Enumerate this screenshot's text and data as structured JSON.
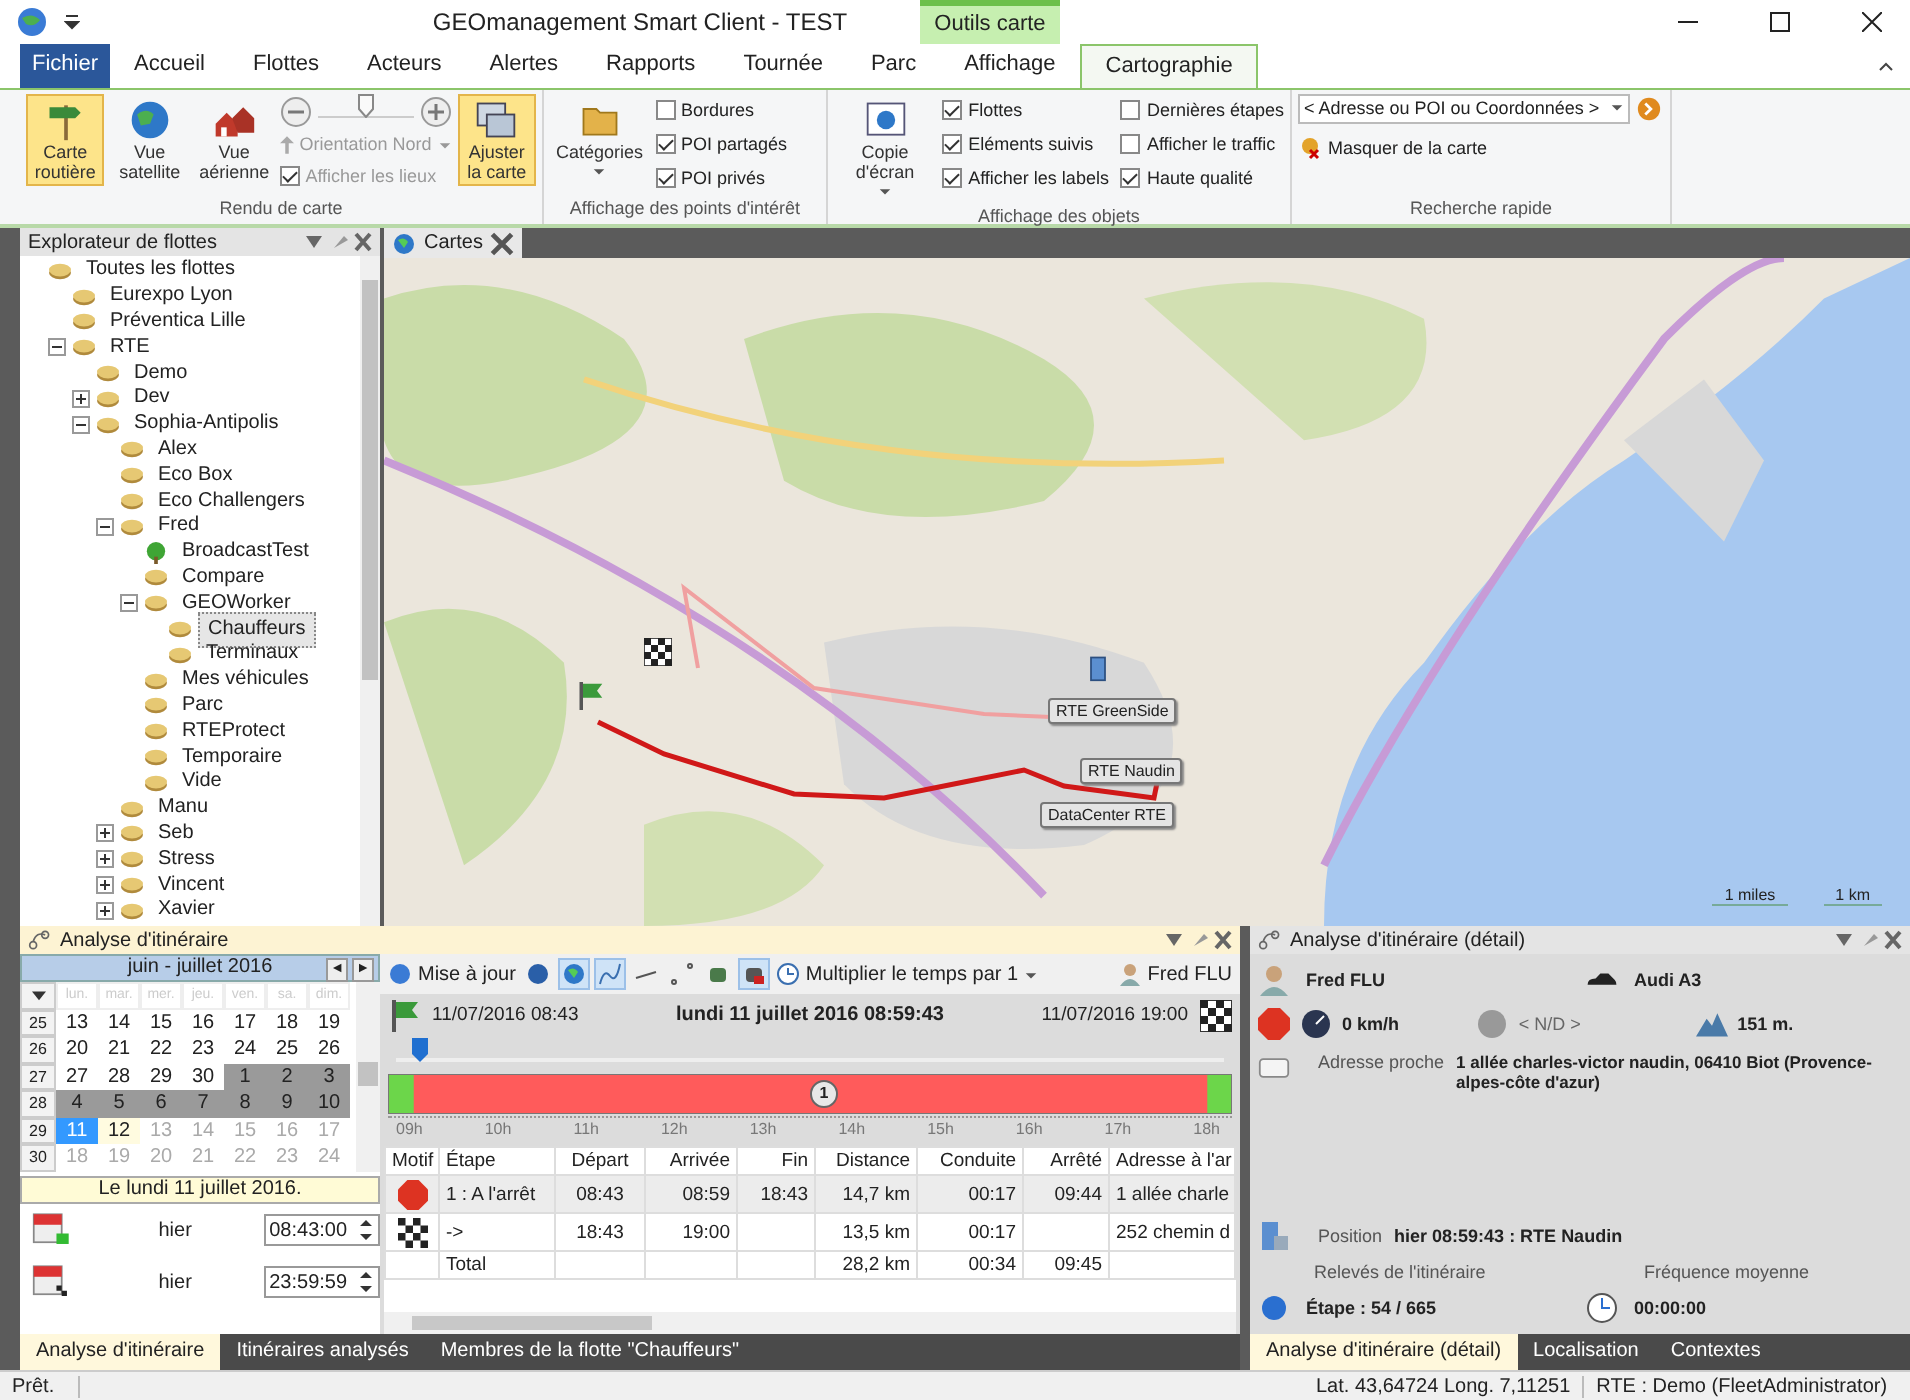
{
  "window": {
    "title": "GEOmanagement Smart Client - TEST",
    "context_tab": "Outils carte"
  },
  "ribbon_tabs": [
    {
      "label": "Fichier",
      "kind": "file",
      "selected": false
    },
    {
      "label": "Accueil",
      "kind": "tab",
      "selected": false
    },
    {
      "label": "Flottes",
      "kind": "tab",
      "selected": false
    },
    {
      "label": "Acteurs",
      "kind": "tab",
      "selected": false
    },
    {
      "label": "Alertes",
      "kind": "tab",
      "selected": false
    },
    {
      "label": "Rapports",
      "kind": "tab",
      "selected": false
    },
    {
      "label": "Tournée",
      "kind": "tab",
      "selected": false
    },
    {
      "label": "Parc",
      "kind": "tab",
      "selected": false
    },
    {
      "label": "Affichage",
      "kind": "tab",
      "selected": false
    },
    {
      "label": "Cartographie",
      "kind": "context",
      "selected": true
    }
  ],
  "ribbon": {
    "rendu": {
      "label": "Rendu de carte",
      "views": [
        {
          "label": "Carte routière",
          "kind": "road",
          "selected": true
        },
        {
          "label": "Vue satellite",
          "kind": "globe",
          "selected": false
        },
        {
          "label": "Vue aérienne",
          "kind": "houses",
          "selected": false
        }
      ],
      "orientation": {
        "label": "Orientation Nord",
        "disabled": true
      },
      "zoom": {
        "level": 0.5
      },
      "show_places": {
        "label": "Afficher les lieux",
        "checked": true,
        "disabled": true
      },
      "fit": {
        "label": "Ajuster la carte",
        "selected": true
      }
    },
    "poi": {
      "label": "Affichage des points d'intérêt",
      "categories": "Catégories",
      "checks": [
        {
          "label": "Bordures",
          "checked": false
        },
        {
          "label": "POI partagés",
          "checked": true
        },
        {
          "label": "POI privés",
          "checked": true
        }
      ]
    },
    "objects": {
      "label": "Affichage des objets",
      "screenshot": "Copie d'écran",
      "checks": [
        {
          "label": "Flottes",
          "checked": true
        },
        {
          "label": "Eléments suivis",
          "checked": true
        },
        {
          "label": "Afficher les labels",
          "checked": true
        },
        {
          "label": "Dernières étapes",
          "checked": false
        },
        {
          "label": "Afficher le traffic",
          "checked": false
        },
        {
          "label": "Haute qualité",
          "checked": true
        }
      ]
    },
    "search": {
      "label": "Recherche rapide",
      "value": "< Adresse ou POI ou Coordonnées >",
      "hide": "Masquer de la carte"
    }
  },
  "explorer": {
    "title": "Explorateur de flottes",
    "items": [
      {
        "label": "Toutes les flottes",
        "kind": "group",
        "selected": false,
        "children": [
          {
            "label": "Eurexpo Lyon",
            "kind": "group",
            "selected": false
          },
          {
            "label": "Préventica Lille",
            "kind": "group",
            "selected": false
          },
          {
            "label": "RTE",
            "kind": "group",
            "selected": false,
            "expanded": true,
            "children": [
              {
                "label": "Demo",
                "kind": "group",
                "selected": false
              },
              {
                "label": "Dev",
                "kind": "group",
                "selected": false,
                "expanded": false
              },
              {
                "label": "Sophia-Antipolis",
                "kind": "group",
                "selected": false,
                "expanded": true,
                "children": [
                  {
                    "label": "Alex",
                    "kind": "group",
                    "selected": false
                  },
                  {
                    "label": "Eco Box",
                    "kind": "group",
                    "selected": false
                  },
                  {
                    "label": "Eco Challengers",
                    "kind": "group",
                    "selected": false
                  },
                  {
                    "label": "Fred",
                    "kind": "group",
                    "selected": false,
                    "expanded": true,
                    "children": [
                      {
                        "label": "BroadcastTest",
                        "kind": "broadcast",
                        "selected": false
                      },
                      {
                        "label": "Compare",
                        "kind": "group",
                        "selected": false
                      },
                      {
                        "label": "GEOWorker",
                        "kind": "group",
                        "selected": false,
                        "expanded": true,
                        "children": [
                          {
                            "label": "Chauffeurs",
                            "kind": "group",
                            "selected": true
                          },
                          {
                            "label": "Terminaux",
                            "kind": "group",
                            "selected": false
                          }
                        ]
                      },
                      {
                        "label": "Mes véhicules",
                        "kind": "group",
                        "selected": false
                      },
                      {
                        "label": "Parc",
                        "kind": "group",
                        "selected": false
                      },
                      {
                        "label": "RTEProtect",
                        "kind": "group",
                        "selected": false
                      },
                      {
                        "label": "Temporaire",
                        "kind": "group",
                        "selected": false
                      },
                      {
                        "label": "Vide",
                        "kind": "group",
                        "selected": false
                      }
                    ]
                  },
                  {
                    "label": "Manu",
                    "kind": "group",
                    "selected": false
                  },
                  {
                    "label": "Seb",
                    "kind": "group",
                    "selected": false,
                    "expanded": false
                  },
                  {
                    "label": "Stress",
                    "kind": "group",
                    "selected": false,
                    "expanded": false
                  },
                  {
                    "label": "Vincent",
                    "kind": "group",
                    "selected": false,
                    "expanded": false
                  },
                  {
                    "label": "Xavier",
                    "kind": "group",
                    "selected": false,
                    "expanded": false
                  }
                ]
              }
            ]
          }
        ]
      }
    ]
  },
  "map": {
    "tab": "Cartes",
    "markers": [
      {
        "label": "RTE GreenSide"
      },
      {
        "label": "RTE Naudin"
      },
      {
        "label": "DataCenter RTE"
      }
    ],
    "scale": [
      "1 miles",
      "1 km"
    ]
  },
  "analysis": {
    "title": "Analyse d'itinéraire",
    "calendar": {
      "month": "juin - juillet 2016",
      "weekdays": [
        "lun.",
        "mar.",
        "mer.",
        "jeu.",
        "ven.",
        "sa.",
        "dim."
      ],
      "nav": [
        "◄",
        "►"
      ],
      "weeks": [
        {
          "week": "25",
          "days": [
            {
              "d": "13",
              "kind": "normal",
              "selected": false
            },
            {
              "d": "14",
              "kind": "normal",
              "selected": false
            },
            {
              "d": "15",
              "kind": "normal",
              "selected": false
            },
            {
              "d": "16",
              "kind": "normal",
              "selected": false
            },
            {
              "d": "17",
              "kind": "normal",
              "selected": false
            },
            {
              "d": "18",
              "kind": "normal",
              "selected": false
            },
            {
              "d": "19",
              "kind": "normal",
              "selected": false
            }
          ]
        },
        {
          "week": "26",
          "days": [
            {
              "d": "20",
              "kind": "normal",
              "selected": false
            },
            {
              "d": "21",
              "kind": "normal",
              "selected": false
            },
            {
              "d": "22",
              "kind": "normal",
              "selected": false
            },
            {
              "d": "23",
              "kind": "normal",
              "selected": false
            },
            {
              "d": "24",
              "kind": "normal",
              "selected": false
            },
            {
              "d": "25",
              "kind": "normal",
              "selected": false
            },
            {
              "d": "26",
              "kind": "normal",
              "selected": false
            }
          ]
        },
        {
          "week": "27",
          "days": [
            {
              "d": "27",
              "kind": "normal",
              "selected": false
            },
            {
              "d": "28",
              "kind": "normal",
              "selected": false
            },
            {
              "d": "29",
              "kind": "normal",
              "selected": false
            },
            {
              "d": "30",
              "kind": "normal",
              "selected": false
            },
            {
              "d": "1",
              "kind": "shaded",
              "selected": false
            },
            {
              "d": "2",
              "kind": "shaded",
              "selected": false
            },
            {
              "d": "3",
              "kind": "shaded",
              "selected": false
            }
          ]
        },
        {
          "week": "28",
          "days": [
            {
              "d": "4",
              "kind": "shaded",
              "selected": false
            },
            {
              "d": "5",
              "kind": "shaded",
              "selected": false
            },
            {
              "d": "6",
              "kind": "shaded",
              "selected": false
            },
            {
              "d": "7",
              "kind": "shaded",
              "selected": false
            },
            {
              "d": "8",
              "kind": "shaded",
              "selected": false
            },
            {
              "d": "9",
              "kind": "shaded",
              "selected": false
            },
            {
              "d": "10",
              "kind": "shaded",
              "selected": false
            }
          ]
        },
        {
          "week": "29",
          "days": [
            {
              "d": "11",
              "kind": "normal",
              "selected": true
            },
            {
              "d": "12",
              "kind": "today",
              "selected": false
            },
            {
              "d": "13",
              "kind": "faded",
              "selected": false
            },
            {
              "d": "14",
              "kind": "faded",
              "selected": false
            },
            {
              "d": "15",
              "kind": "faded",
              "selected": false
            },
            {
              "d": "16",
              "kind": "faded",
              "selected": false
            },
            {
              "d": "17",
              "kind": "faded",
              "selected": false
            }
          ]
        },
        {
          "week": "30",
          "days": [
            {
              "d": "18",
              "kind": "faded",
              "selected": false
            },
            {
              "d": "19",
              "kind": "faded",
              "selected": false
            },
            {
              "d": "20",
              "kind": "faded",
              "selected": false
            },
            {
              "d": "21",
              "kind": "faded",
              "selected": false
            },
            {
              "d": "22",
              "kind": "faded",
              "selected": false
            },
            {
              "d": "23",
              "kind": "faded",
              "selected": false
            },
            {
              "d": "24",
              "kind": "faded",
              "selected": false
            }
          ]
        }
      ],
      "footer": "Le lundi 11 juillet 2016."
    },
    "times": [
      {
        "kind": "start",
        "day": "hier",
        "value": "08:43:00"
      },
      {
        "kind": "end",
        "day": "hier",
        "value": "23:59:59"
      }
    ],
    "toolbar": {
      "update": "Mise à jour",
      "multiply": "Multiplier le temps par 1",
      "user": "Fred FLU"
    },
    "timeline": {
      "start": "11/07/2016 08:43",
      "current": "lundi 11 juillet 2016 08:59:43",
      "end": "11/07/2016 19:00",
      "level": 0.02,
      "stop_label": "1",
      "hours": [
        "09h",
        "10h",
        "11h",
        "12h",
        "13h",
        "14h",
        "15h",
        "16h",
        "17h",
        "18h"
      ]
    },
    "table": {
      "columns": [
        "Motif",
        "Étape",
        "Départ",
        "Arrivée",
        "Fin",
        "Distance",
        "Conduite",
        "Arrêté",
        "Adresse à l'ar"
      ],
      "rows": [
        {
          "kind": "stop",
          "cells": [
            "",
            "1 : A l'arrêt",
            "08:43",
            "08:59",
            "18:43",
            "14,7 km",
            "00:17",
            "09:44",
            "1 allée charle"
          ]
        },
        {
          "kind": "finish",
          "cells": [
            "",
            "->",
            "18:43",
            "19:00",
            "",
            "13,5 km",
            "00:17",
            "",
            "252 chemin d"
          ]
        },
        {
          "kind": "total",
          "cells": [
            "",
            "Total",
            "",
            "",
            "",
            "28,2 km",
            "00:34",
            "09:45",
            ""
          ]
        }
      ]
    },
    "tabs": [
      {
        "label": "Analyse d'itinéraire",
        "selected": true
      },
      {
        "label": "Itinéraires analysés",
        "selected": false
      },
      {
        "label": "Membres de la flotte \"Chauffeurs\"",
        "selected": false
      }
    ]
  },
  "detail": {
    "title": "Analyse d'itinéraire (détail)",
    "driver": "Fred FLU",
    "vehicle": "Audi A3",
    "speed": "0 km/h",
    "heading": "< N/D >",
    "altitude": "151 m.",
    "address_label": "Adresse proche",
    "address": "1 allée charles-victor naudin, 06410 Biot (Provence-alpes-côte d'azur)",
    "position_label": "Position",
    "position": "hier 08:59:43 : RTE Naudin",
    "readings_label": "Relevés de l'itinéraire",
    "frequency_label": "Fréquence moyenne",
    "step": "Étape : 54 / 665",
    "frequency": "00:00:00",
    "tabs": [
      {
        "label": "Analyse d'itinéraire (détail)",
        "selected": true
      },
      {
        "label": "Localisation",
        "selected": false
      },
      {
        "label": "Contextes",
        "selected": false
      }
    ]
  },
  "status_bar": {
    "state": "Prêt.",
    "coords": "Lat. 43,64724 Long. 7,11251",
    "user": "RTE : Demo (FleetAdministrator)"
  }
}
